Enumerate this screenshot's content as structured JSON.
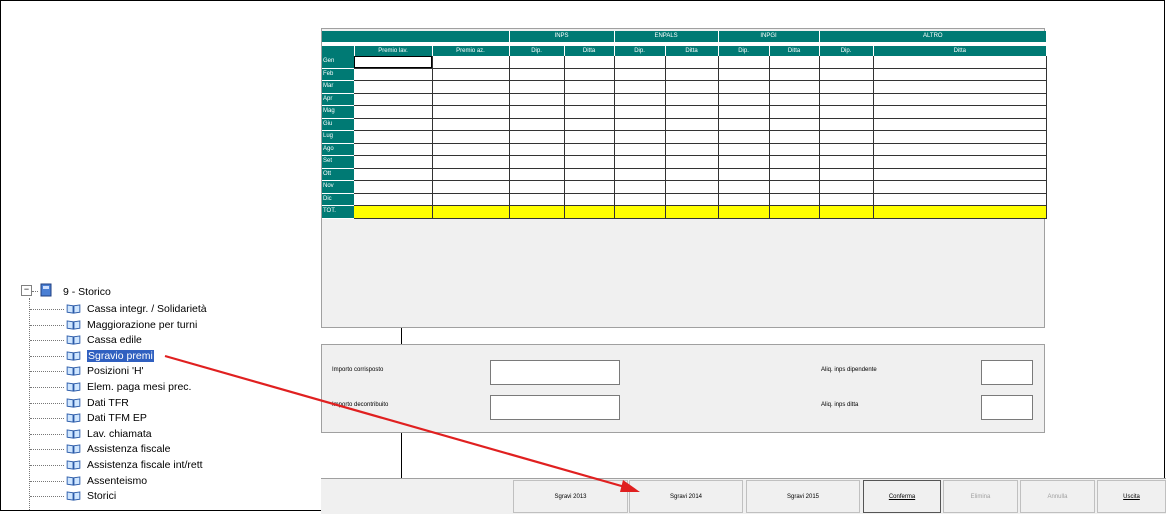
{
  "grid": {
    "groups": [
      "INPS",
      "ENPALS",
      "INPGI",
      "ALTRO"
    ],
    "columns": [
      "Premio lav.",
      "Premio az.",
      "Dip.",
      "Ditta",
      "Dip.",
      "Ditta",
      "Dip.",
      "Ditta",
      "Dip.",
      "Ditta"
    ],
    "months": [
      "Gen",
      "Feb",
      "Mar",
      "Apr",
      "Mag",
      "Giu",
      "Lug",
      "Ago",
      "Set",
      "Ott",
      "Nov",
      "Dic"
    ],
    "total_label": "TOT."
  },
  "form": {
    "importo_corrisposto": "Importo corrisposto",
    "importo_decontribuito": "Importo decontribuito",
    "aliq_dipendente": "Aliq. inps dipendente",
    "aliq_ditta": "Aliq. inps ditta"
  },
  "buttons": {
    "sgravi2013": "Sgravi 2013",
    "sgravi2014": "Sgravi 2014",
    "sgravi2015": "Sgravi 2015",
    "conferma": "Conferma",
    "elimina": "Elimina",
    "annulla": "Annulla",
    "uscita": "Uscita"
  },
  "tree": {
    "root": "9 - Storico",
    "items": [
      "Cassa integr. / Solidarietà",
      "Maggiorazione per turni",
      "Cassa edile",
      "Sgravio premi",
      "Posizioni 'H'",
      "Elem. paga mesi prec.",
      "Dati TFR",
      "Dati TFM EP",
      "Lav. chiamata",
      "Assistenza fiscale",
      "Assistenza fiscale int/rett",
      "Assenteismo",
      "Storici"
    ],
    "selected_index": 3
  },
  "colors": {
    "header_teal": "#007a74",
    "total_row": "#ffff00",
    "arrow": "#e02020",
    "selection": "#3060c0"
  }
}
